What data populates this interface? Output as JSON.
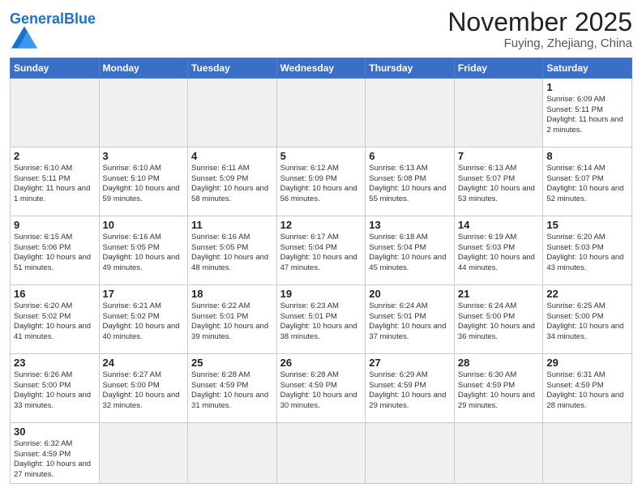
{
  "header": {
    "logo_general": "General",
    "logo_blue": "Blue",
    "month_title": "November 2025",
    "location": "Fuying, Zhejiang, China"
  },
  "weekdays": [
    "Sunday",
    "Monday",
    "Tuesday",
    "Wednesday",
    "Thursday",
    "Friday",
    "Saturday"
  ],
  "weeks": [
    [
      {
        "day": "",
        "info": ""
      },
      {
        "day": "",
        "info": ""
      },
      {
        "day": "",
        "info": ""
      },
      {
        "day": "",
        "info": ""
      },
      {
        "day": "",
        "info": ""
      },
      {
        "day": "",
        "info": ""
      },
      {
        "day": "1",
        "info": "Sunrise: 6:09 AM\nSunset: 5:11 PM\nDaylight: 11 hours\nand 2 minutes."
      }
    ],
    [
      {
        "day": "2",
        "info": "Sunrise: 6:10 AM\nSunset: 5:11 PM\nDaylight: 11 hours\nand 1 minute."
      },
      {
        "day": "3",
        "info": "Sunrise: 6:10 AM\nSunset: 5:10 PM\nDaylight: 10 hours\nand 59 minutes."
      },
      {
        "day": "4",
        "info": "Sunrise: 6:11 AM\nSunset: 5:09 PM\nDaylight: 10 hours\nand 58 minutes."
      },
      {
        "day": "5",
        "info": "Sunrise: 6:12 AM\nSunset: 5:09 PM\nDaylight: 10 hours\nand 56 minutes."
      },
      {
        "day": "6",
        "info": "Sunrise: 6:13 AM\nSunset: 5:08 PM\nDaylight: 10 hours\nand 55 minutes."
      },
      {
        "day": "7",
        "info": "Sunrise: 6:13 AM\nSunset: 5:07 PM\nDaylight: 10 hours\nand 53 minutes."
      },
      {
        "day": "8",
        "info": "Sunrise: 6:14 AM\nSunset: 5:07 PM\nDaylight: 10 hours\nand 52 minutes."
      }
    ],
    [
      {
        "day": "9",
        "info": "Sunrise: 6:15 AM\nSunset: 5:06 PM\nDaylight: 10 hours\nand 51 minutes."
      },
      {
        "day": "10",
        "info": "Sunrise: 6:16 AM\nSunset: 5:05 PM\nDaylight: 10 hours\nand 49 minutes."
      },
      {
        "day": "11",
        "info": "Sunrise: 6:16 AM\nSunset: 5:05 PM\nDaylight: 10 hours\nand 48 minutes."
      },
      {
        "day": "12",
        "info": "Sunrise: 6:17 AM\nSunset: 5:04 PM\nDaylight: 10 hours\nand 47 minutes."
      },
      {
        "day": "13",
        "info": "Sunrise: 6:18 AM\nSunset: 5:04 PM\nDaylight: 10 hours\nand 45 minutes."
      },
      {
        "day": "14",
        "info": "Sunrise: 6:19 AM\nSunset: 5:03 PM\nDaylight: 10 hours\nand 44 minutes."
      },
      {
        "day": "15",
        "info": "Sunrise: 6:20 AM\nSunset: 5:03 PM\nDaylight: 10 hours\nand 43 minutes."
      }
    ],
    [
      {
        "day": "16",
        "info": "Sunrise: 6:20 AM\nSunset: 5:02 PM\nDaylight: 10 hours\nand 41 minutes."
      },
      {
        "day": "17",
        "info": "Sunrise: 6:21 AM\nSunset: 5:02 PM\nDaylight: 10 hours\nand 40 minutes."
      },
      {
        "day": "18",
        "info": "Sunrise: 6:22 AM\nSunset: 5:01 PM\nDaylight: 10 hours\nand 39 minutes."
      },
      {
        "day": "19",
        "info": "Sunrise: 6:23 AM\nSunset: 5:01 PM\nDaylight: 10 hours\nand 38 minutes."
      },
      {
        "day": "20",
        "info": "Sunrise: 6:24 AM\nSunset: 5:01 PM\nDaylight: 10 hours\nand 37 minutes."
      },
      {
        "day": "21",
        "info": "Sunrise: 6:24 AM\nSunset: 5:00 PM\nDaylight: 10 hours\nand 36 minutes."
      },
      {
        "day": "22",
        "info": "Sunrise: 6:25 AM\nSunset: 5:00 PM\nDaylight: 10 hours\nand 34 minutes."
      }
    ],
    [
      {
        "day": "23",
        "info": "Sunrise: 6:26 AM\nSunset: 5:00 PM\nDaylight: 10 hours\nand 33 minutes."
      },
      {
        "day": "24",
        "info": "Sunrise: 6:27 AM\nSunset: 5:00 PM\nDaylight: 10 hours\nand 32 minutes."
      },
      {
        "day": "25",
        "info": "Sunrise: 6:28 AM\nSunset: 4:59 PM\nDaylight: 10 hours\nand 31 minutes."
      },
      {
        "day": "26",
        "info": "Sunrise: 6:28 AM\nSunset: 4:59 PM\nDaylight: 10 hours\nand 30 minutes."
      },
      {
        "day": "27",
        "info": "Sunrise: 6:29 AM\nSunset: 4:59 PM\nDaylight: 10 hours\nand 29 minutes."
      },
      {
        "day": "28",
        "info": "Sunrise: 6:30 AM\nSunset: 4:59 PM\nDaylight: 10 hours\nand 29 minutes."
      },
      {
        "day": "29",
        "info": "Sunrise: 6:31 AM\nSunset: 4:59 PM\nDaylight: 10 hours\nand 28 minutes."
      }
    ],
    [
      {
        "day": "30",
        "info": "Sunrise: 6:32 AM\nSunset: 4:59 PM\nDaylight: 10 hours\nand 27 minutes."
      },
      {
        "day": "",
        "info": ""
      },
      {
        "day": "",
        "info": ""
      },
      {
        "day": "",
        "info": ""
      },
      {
        "day": "",
        "info": ""
      },
      {
        "day": "",
        "info": ""
      },
      {
        "day": "",
        "info": ""
      }
    ]
  ]
}
